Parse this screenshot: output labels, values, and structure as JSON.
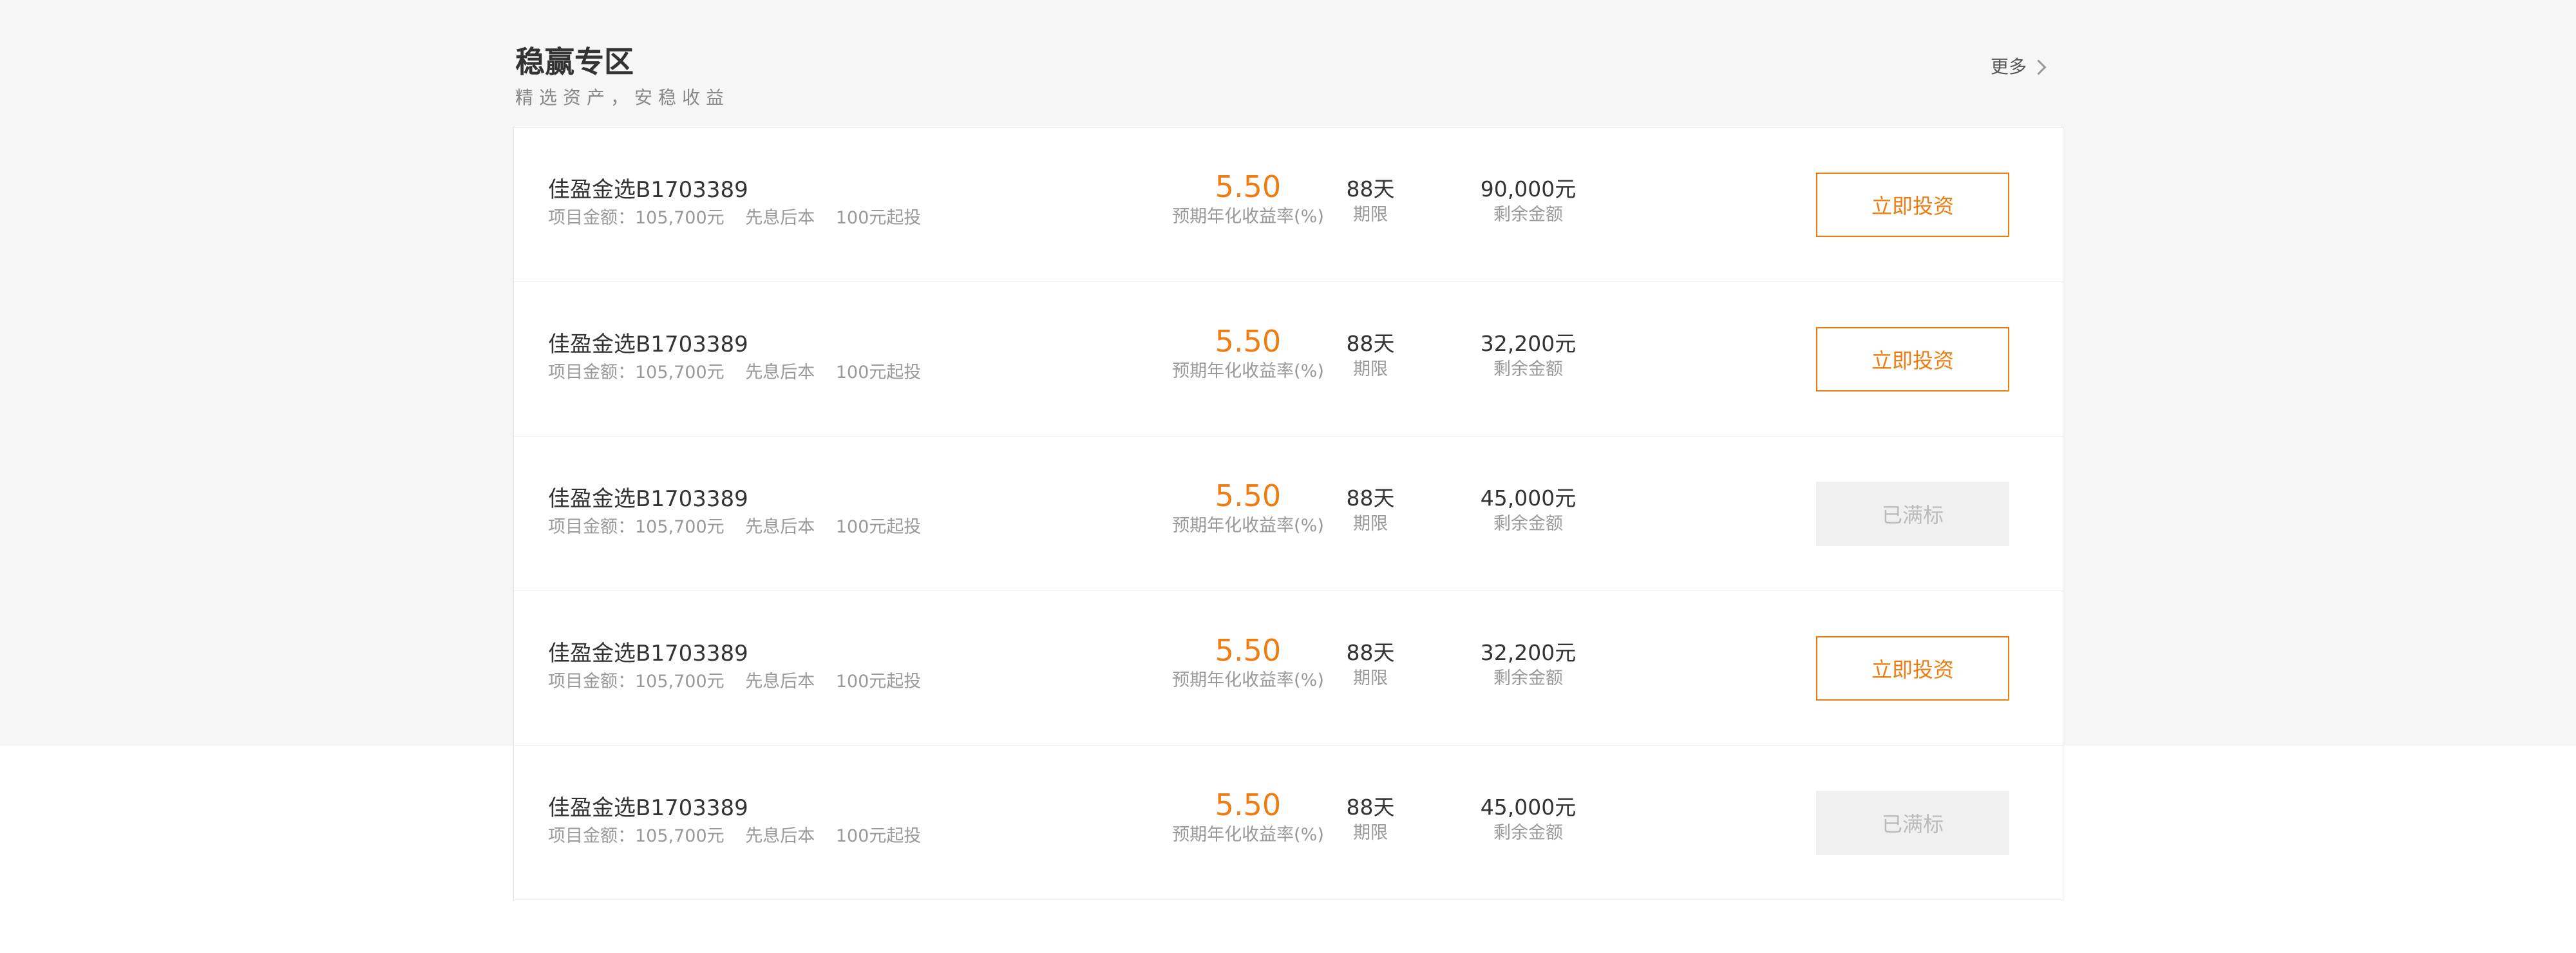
{
  "section": {
    "title": "稳赢专区",
    "subtitle": "精选资产，安稳收益",
    "more_label": "更多",
    "more_icon": "chevron-right-icon"
  },
  "colors": {
    "accent": "#ef7c10",
    "top_background": "#f6f6f6",
    "disabled_button": "#f0f0f0"
  },
  "products": [
    {
      "name": "佳盈金选B1703389",
      "amount": "项目金额：105,700元",
      "repayment": "先息后本",
      "min_invest": "100元起投",
      "rate": "5.50",
      "rate_label": "预期年化收益率(%)",
      "term": "88天",
      "term_label": "期限",
      "remaining": "90,000元",
      "remaining_label": "剩余金额",
      "button_label": "立即投资",
      "status": "active"
    },
    {
      "name": "佳盈金选B1703389",
      "amount": "项目金额：105,700元",
      "repayment": "先息后本",
      "min_invest": "100元起投",
      "rate": "5.50",
      "rate_label": "预期年化收益率(%)",
      "term": "88天",
      "term_label": "期限",
      "remaining": "32,200元",
      "remaining_label": "剩余金额",
      "button_label": "立即投资",
      "status": "active"
    },
    {
      "name": "佳盈金选B1703389",
      "amount": "项目金额：105,700元",
      "repayment": "先息后本",
      "min_invest": "100元起投",
      "rate": "5.50",
      "rate_label": "预期年化收益率(%)",
      "term": "88天",
      "term_label": "期限",
      "remaining": "45,000元",
      "remaining_label": "剩余金额",
      "button_label": "已满标",
      "status": "full"
    },
    {
      "name": "佳盈金选B1703389",
      "amount": "项目金额：105,700元",
      "repayment": "先息后本",
      "min_invest": "100元起投",
      "rate": "5.50",
      "rate_label": "预期年化收益率(%)",
      "term": "88天",
      "term_label": "期限",
      "remaining": "32,200元",
      "remaining_label": "剩余金额",
      "button_label": "立即投资",
      "status": "active"
    },
    {
      "name": "佳盈金选B1703389",
      "amount": "项目金额：105,700元",
      "repayment": "先息后本",
      "min_invest": "100元起投",
      "rate": "5.50",
      "rate_label": "预期年化收益率(%)",
      "term": "88天",
      "term_label": "期限",
      "remaining": "45,000元",
      "remaining_label": "剩余金额",
      "button_label": "已满标",
      "status": "full"
    }
  ]
}
